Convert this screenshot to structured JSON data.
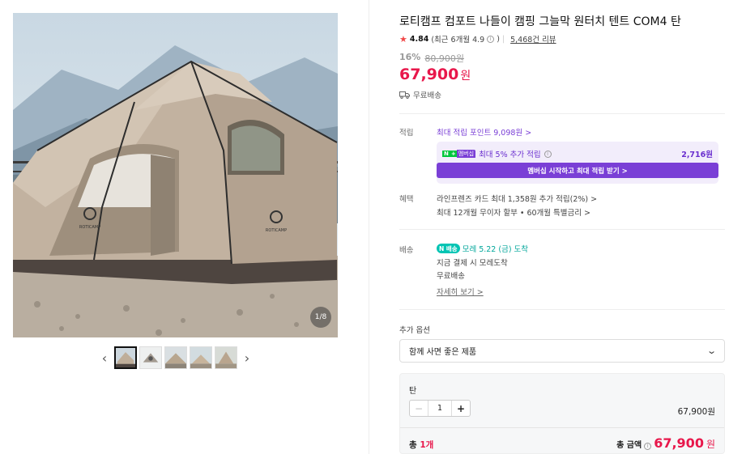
{
  "gallery": {
    "counter": "1/8",
    "prev_icon": "chevron-left-icon",
    "next_icon": "chevron-right-icon",
    "thumbnails": 5,
    "tent_brand": "ROTICAMP"
  },
  "product": {
    "title": "로티캠프 컴포트 나들이 캠핑 그늘막 원터치 텐트 COM4 탄",
    "rating": "4.84",
    "rating_recent": "(최근 6개월 4.9",
    "rating_recent_close": ")",
    "review_count": "5,468건 리뷰",
    "discount_rate": "16%",
    "original_price": "80,900원",
    "price": "67,900",
    "price_unit": "원",
    "shipping": "무료배송"
  },
  "points": {
    "label": "적립",
    "max_point": "최대 적립 포인트 9,098원 >",
    "membership_badge_n": "N",
    "membership_badge_plus": "+",
    "membership_badge_text": "멤버십",
    "membership_text": "최대 5% 추가 적립",
    "membership_amount": "2,716원",
    "membership_button": "멤버십 시작하고 최대 적립 받기 >"
  },
  "benefits": {
    "label": "혜택",
    "line1": "라인프렌즈 카드 최대 1,358원 추가 적립(2%) >",
    "line2": "최대 12개월 무이자 할부 • 60개월 특별금리 >"
  },
  "delivery": {
    "label": "배송",
    "badge": "N 배송",
    "main": "모레 5.22 (금) 도착",
    "line2": "지금 결제 시 모레도착",
    "line3": "무료배송",
    "detail_link": "자세히 보기 >"
  },
  "options": {
    "label": "추가 옵션",
    "select_value": "함께 사면 좋은 제품"
  },
  "selected": {
    "name": "탄",
    "quantity": "1",
    "price": "67,900원",
    "total_count_prefix": "총 ",
    "total_count": "1개",
    "total_label": "총 금액",
    "total_price": "67,900",
    "total_unit": "원"
  },
  "colors": {
    "price_red": "#e8174b",
    "membership_purple": "#7a3fd6",
    "delivery_teal": "#00c4b3",
    "star_red": "#f04848"
  }
}
